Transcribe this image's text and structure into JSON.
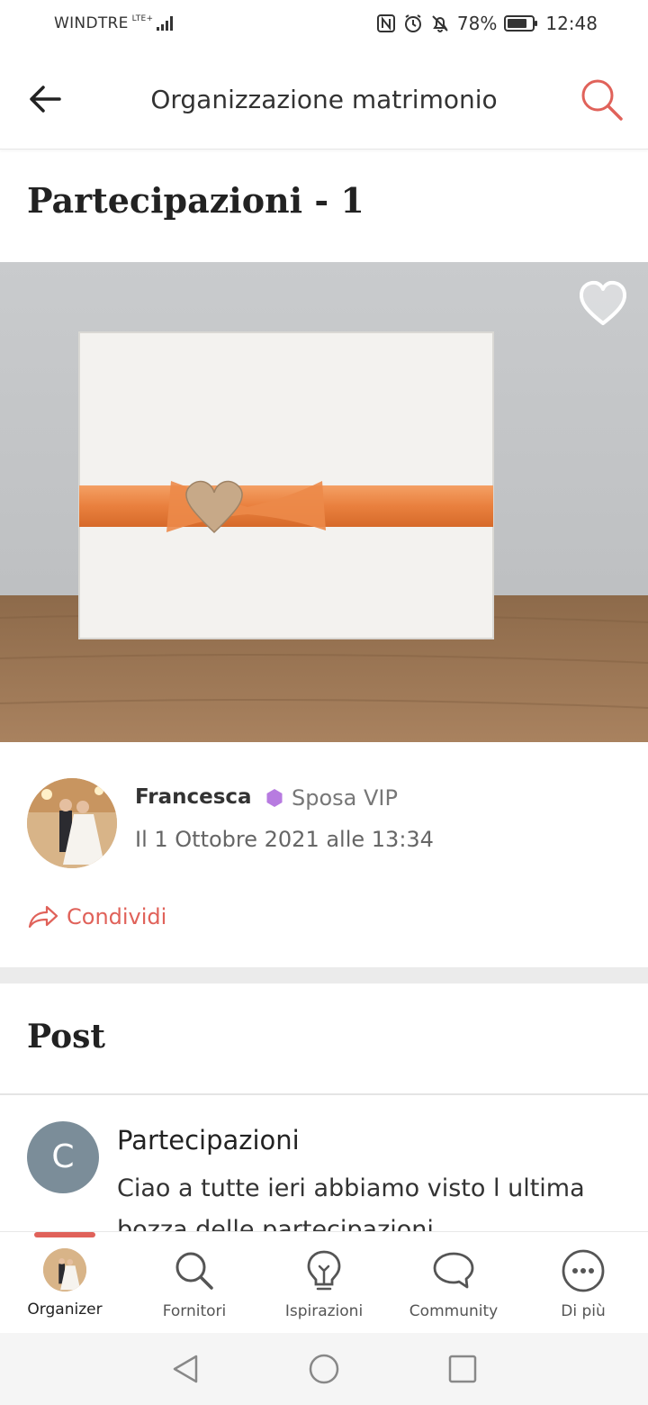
{
  "status_bar": {
    "carrier": "WINDTRE",
    "network": "LTE+",
    "battery": "78%",
    "battery_level": 0.78,
    "time": "12:48"
  },
  "app_bar": {
    "title": "Organizzazione matrimonio",
    "back_icon": "arrow-left-icon",
    "search_icon": "search-icon"
  },
  "page": {
    "title": "Partecipazioni - 1"
  },
  "photo": {
    "favorite_icon": "heart-icon"
  },
  "author": {
    "name": "Francesca",
    "badge": "Sposa VIP",
    "date": "Il 1 Ottobre 2021 alle 13:34"
  },
  "share": {
    "label": "Condividi"
  },
  "posts": {
    "heading": "Post",
    "items": [
      {
        "avatar_letter": "C",
        "title": "Partecipazioni",
        "excerpt": "Ciao a tutte ieri abbiamo visto l ultima bozza delle partecipazioni"
      }
    ]
  },
  "bottom_nav": {
    "items": [
      {
        "label": "Organizer",
        "icon": "avatar-icon"
      },
      {
        "label": "Fornitori",
        "icon": "search-icon"
      },
      {
        "label": "Ispirazioni",
        "icon": "lightbulb-icon"
      },
      {
        "label": "Community",
        "icon": "chat-bubble-icon"
      },
      {
        "label": "Di più",
        "icon": "more-dots-icon"
      }
    ]
  },
  "colors": {
    "accent": "#e0625a",
    "vip_badge": "#b77be0",
    "avatar_c": "#7b8d99"
  }
}
